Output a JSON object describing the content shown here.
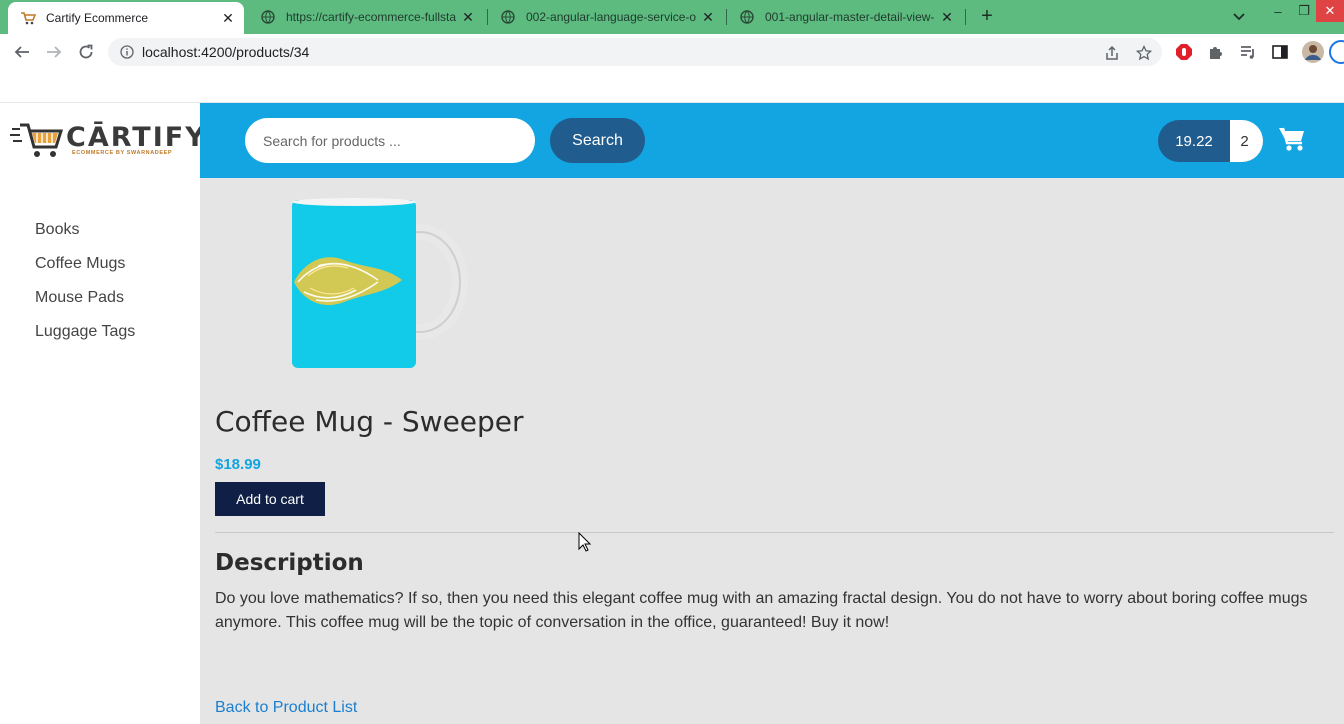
{
  "browser": {
    "tabs": [
      {
        "title": "Cartify Ecommerce",
        "active": true
      },
      {
        "title": "https://cartify-ecommerce-fullsta",
        "active": false
      },
      {
        "title": "002-angular-language-service-o",
        "active": false
      },
      {
        "title": "001-angular-master-detail-view-",
        "active": false
      }
    ],
    "url": "localhost:4200/products/34",
    "colors": {
      "tabstrip": "#5dbb80",
      "close": "#e04343"
    }
  },
  "header": {
    "logo_text": "CĀRTIFY",
    "logo_sub": "ECOMMERCE BY SWARNADEEP",
    "search_placeholder": "Search for products ...",
    "search_label": "Search",
    "cart_total": "19.22",
    "cart_quantity": "2",
    "colors": {
      "bar": "#13a5e2",
      "button": "#205c8e"
    }
  },
  "sidebar": {
    "items": [
      {
        "label": "Books"
      },
      {
        "label": "Coffee Mugs"
      },
      {
        "label": "Mouse Pads"
      },
      {
        "label": "Luggage Tags"
      }
    ]
  },
  "product": {
    "name": "Coffee Mug - Sweeper",
    "price": "$18.99",
    "add_to_cart_label": "Add to cart",
    "description_heading": "Description",
    "description": "Do you love mathematics? If so, then you need this elegant coffee mug with an amazing fractal design. You do not have to worry about boring coffee mugs anymore. This coffee mug will be the topic of conversation in the office, guaranteed! Buy it now!",
    "back_link": "Back to Product List"
  }
}
